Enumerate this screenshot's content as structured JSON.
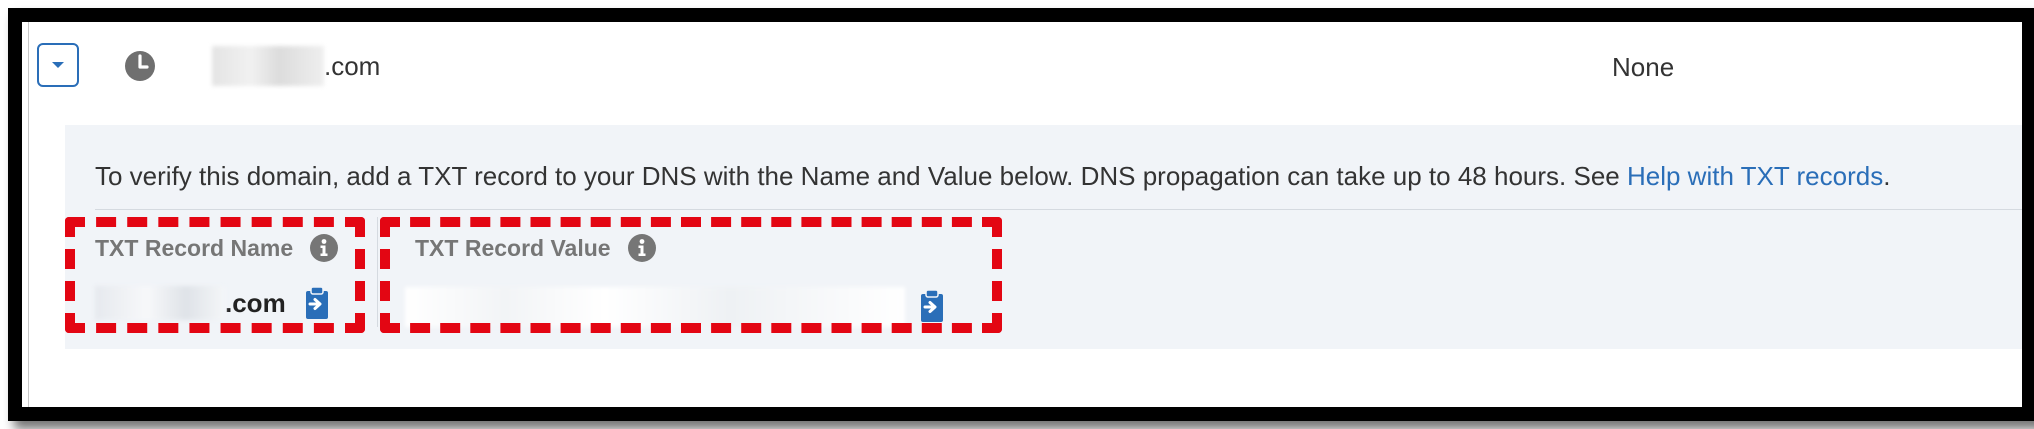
{
  "row": {
    "domain_suffix": ".com",
    "status": "None"
  },
  "icons": {
    "expand": "chevron-down-icon",
    "status": "clock-icon",
    "info": "info-icon",
    "copy": "copy-clipboard-icon"
  },
  "verification": {
    "message_prefix": "To verify this domain, add a TXT record to your DNS with the Name and Value below. DNS propagation can take up to 48 hours. See ",
    "help_link": "Help with TXT records",
    "message_suffix": ".",
    "name_label": "TXT Record Name",
    "name_value_suffix": ".com",
    "value_label": "TXT Record Value"
  },
  "colors": {
    "accent": "#2a6eb8",
    "highlight": "#e30613",
    "panel_bg": "#f1f4f8"
  }
}
